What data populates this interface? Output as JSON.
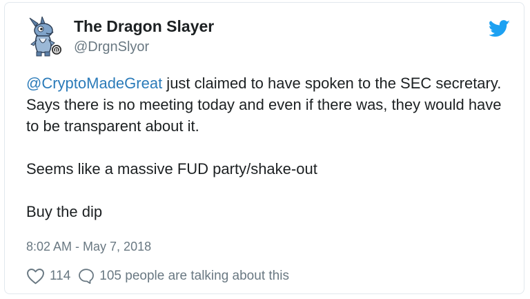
{
  "tweet": {
    "author": {
      "display_name": "The Dragon Slayer",
      "handle": "@DrgnSlyor",
      "avatar_icon": "dragon-cartoon-avatar-icon"
    },
    "brand_icon": "twitter-bird-icon",
    "text": {
      "mention": "@CryptoMadeGreat",
      "line1_rest": " just claimed to have spoken to the SEC secretary. Says there is no meeting today and even if there was, they would have to be transparent about it.",
      "paragraph2": "Seems like a massive FUD party/shake-out",
      "paragraph3": "Buy the dip"
    },
    "timestamp": "8:02 AM - May 7, 2018",
    "actions": {
      "like_icon": "heart-icon",
      "like_count": "114",
      "reply_icon": "speech-bubble-icon",
      "reply_text": "105 people are talking about this"
    }
  },
  "colors": {
    "text": "#1c2022",
    "secondary": "#697882",
    "link": "#2b7bb9",
    "twitter_blue": "#1da1f2",
    "border": "#e1e8ed"
  }
}
